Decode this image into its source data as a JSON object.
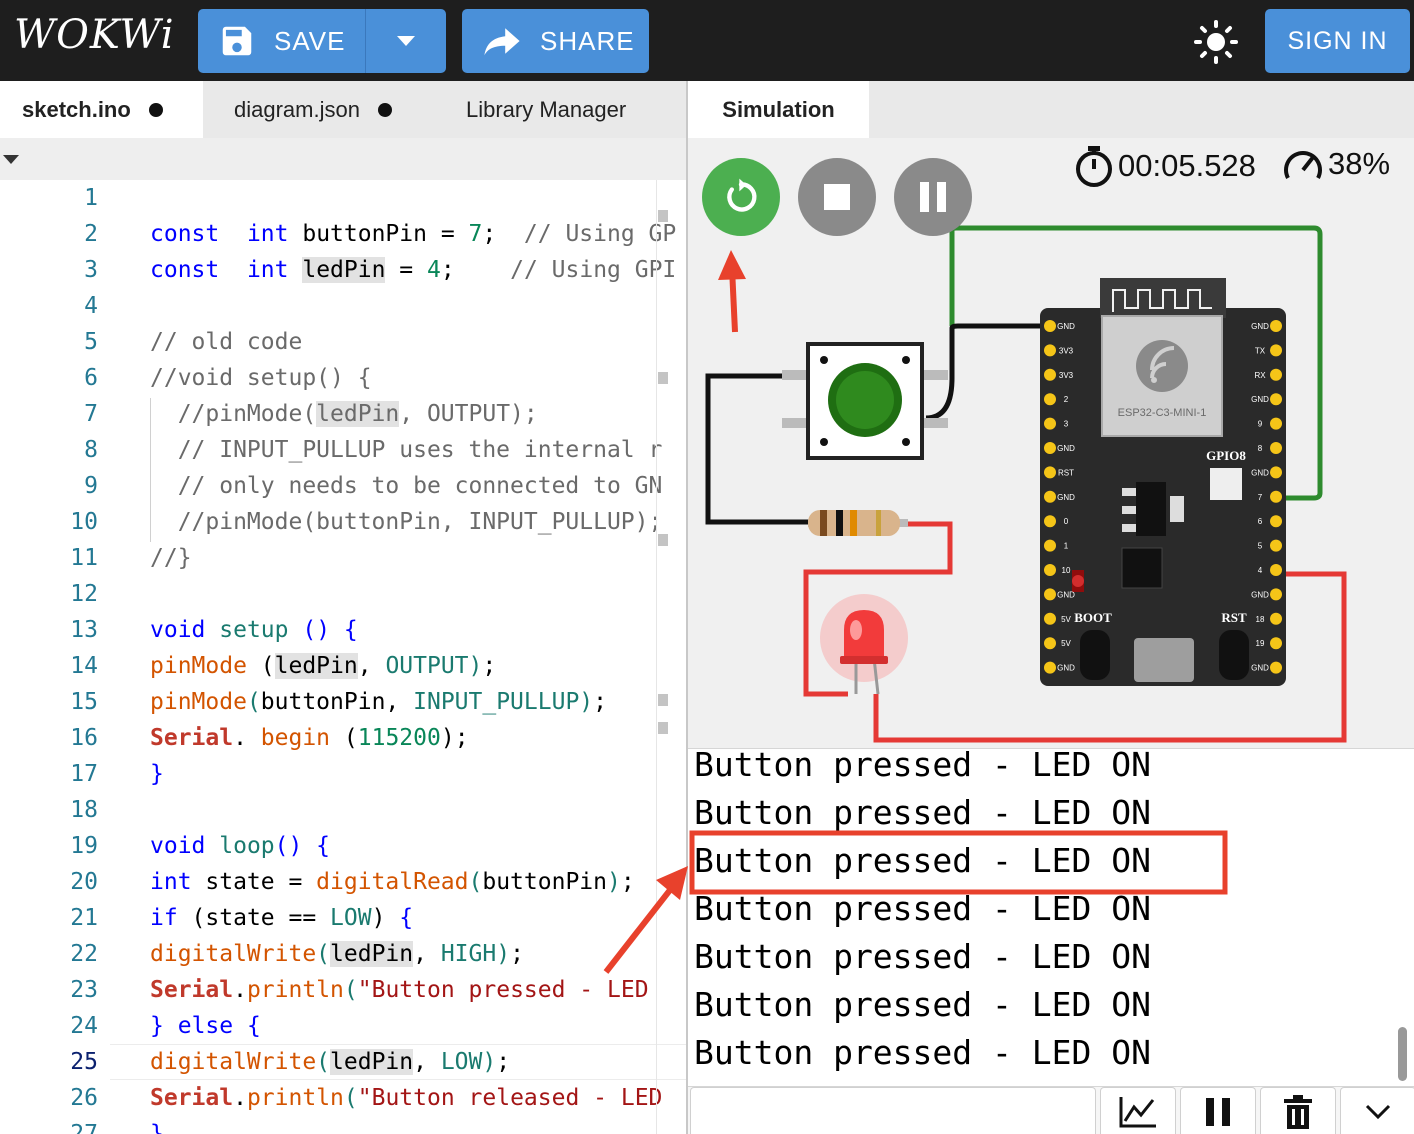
{
  "app": {
    "logo": "WOKWi",
    "save_label": "SAVE",
    "share_label": "SHARE",
    "signin_label": "SIGN IN"
  },
  "tabs": [
    {
      "label": "sketch.ino",
      "active": true,
      "modified": true
    },
    {
      "label": "diagram.json",
      "active": false,
      "modified": true
    },
    {
      "label": "Library Manager",
      "active": false,
      "modified": false
    }
  ],
  "simulation": {
    "tab_label": "Simulation",
    "timer": "00:05.528",
    "speed": "38%",
    "board_label": "ESP32-C3-MINI-1",
    "gpio_label": "GPIO8",
    "boot_label": "BOOT",
    "rst_label": "RST",
    "left_pins": "GND 3V3 3V3 2 3 GND RST GND 0 1 10 GND 5V 5V GND",
    "right_pins": "GND TX RX GND 9 8 GND 7 6 5 4 GND 18 19 GND"
  },
  "code": {
    "current_line": 25,
    "lines": [
      {
        "n": "1",
        "parts": []
      },
      {
        "n": "2",
        "parts": [
          [
            "kw",
            "const"
          ],
          [
            "",
            "  "
          ],
          [
            "kw",
            "int"
          ],
          [
            "",
            " buttonPin = "
          ],
          [
            "num",
            "7"
          ],
          [
            "",
            ";  "
          ],
          [
            "cm",
            "// Using GP"
          ]
        ]
      },
      {
        "n": "3",
        "parts": [
          [
            "kw",
            "const"
          ],
          [
            "",
            "  "
          ],
          [
            "kw",
            "int"
          ],
          [
            "",
            " "
          ],
          [
            "hl",
            "ledPin"
          ],
          [
            "",
            " = "
          ],
          [
            "num",
            "4"
          ],
          [
            "",
            ";    "
          ],
          [
            "cm",
            "// Using GPI"
          ]
        ]
      },
      {
        "n": "4",
        "parts": []
      },
      {
        "n": "5",
        "parts": [
          [
            "cm",
            "// old code"
          ]
        ]
      },
      {
        "n": "6",
        "parts": [
          [
            "cm",
            "//void setup() {"
          ]
        ]
      },
      {
        "n": "7",
        "parts": [
          [
            "cm",
            "  //pinMode("
          ],
          [
            "cmhl",
            "ledPin"
          ],
          [
            "cm",
            ", OUTPUT);"
          ]
        ]
      },
      {
        "n": "8",
        "parts": [
          [
            "cm",
            "  // INPUT_PULLUP uses the internal r"
          ]
        ]
      },
      {
        "n": "9",
        "parts": [
          [
            "cm",
            "  // only needs to be connected to GN"
          ]
        ]
      },
      {
        "n": "10",
        "parts": [
          [
            "cm",
            "  //pinMode(buttonPin, INPUT_PULLUP);"
          ]
        ]
      },
      {
        "n": "11",
        "parts": [
          [
            "cm",
            "//}"
          ]
        ]
      },
      {
        "n": "12",
        "parts": []
      },
      {
        "n": "13",
        "parts": [
          [
            "kw",
            "void"
          ],
          [
            "",
            " "
          ],
          [
            "tk",
            "setup"
          ],
          [
            "",
            " "
          ],
          [
            "kw",
            "() {"
          ]
        ]
      },
      {
        "n": "14",
        "parts": [
          [
            "fn",
            "pinMode"
          ],
          [
            "",
            " ("
          ],
          [
            "hl",
            "ledPin"
          ],
          [
            "",
            ", "
          ],
          [
            "tk",
            "OUTPUT"
          ],
          [
            "tk",
            ")"
          ],
          [
            "",
            ";"
          ]
        ]
      },
      {
        "n": "15",
        "parts": [
          [
            "fn",
            "pinMode"
          ],
          [
            "tk",
            "("
          ],
          [
            "",
            "buttonPin, "
          ],
          [
            "tk",
            "INPUT_PULLUP"
          ],
          [
            "tk",
            ")"
          ],
          [
            "",
            ";"
          ]
        ]
      },
      {
        "n": "16",
        "parts": [
          [
            "obj",
            "Serial"
          ],
          [
            "",
            ". "
          ],
          [
            "fn",
            "begin"
          ],
          [
            "",
            " ("
          ],
          [
            "num",
            "115200"
          ],
          [
            "",
            ");"
          ]
        ]
      },
      {
        "n": "17",
        "parts": [
          [
            "kw",
            "}"
          ]
        ]
      },
      {
        "n": "18",
        "parts": []
      },
      {
        "n": "19",
        "parts": [
          [
            "kw",
            "void"
          ],
          [
            "",
            " "
          ],
          [
            "tk",
            "loop"
          ],
          [
            "kw",
            "() {"
          ]
        ]
      },
      {
        "n": "20",
        "parts": [
          [
            "kw",
            "int"
          ],
          [
            "",
            " state = "
          ],
          [
            "fn",
            "digitalRead"
          ],
          [
            "tk",
            "("
          ],
          [
            "",
            "buttonPin"
          ],
          [
            "tk",
            ")"
          ],
          [
            "",
            ";"
          ]
        ]
      },
      {
        "n": "21",
        "parts": [
          [
            "kw",
            "if"
          ],
          [
            "",
            " ("
          ],
          [
            "",
            "state == "
          ],
          [
            "tk",
            "LOW"
          ],
          [
            "",
            ")"
          ],
          [
            "kw",
            " {"
          ]
        ]
      },
      {
        "n": "22",
        "parts": [
          [
            "fn",
            "digitalWrite"
          ],
          [
            "tk",
            "("
          ],
          [
            "hl",
            "ledPin"
          ],
          [
            "",
            ", "
          ],
          [
            "tk",
            "HIGH"
          ],
          [
            "tk",
            ")"
          ],
          [
            "",
            ";"
          ]
        ]
      },
      {
        "n": "23",
        "parts": [
          [
            "obj",
            "Serial"
          ],
          [
            "",
            "."
          ],
          [
            "fn",
            "println"
          ],
          [
            "tk",
            "("
          ],
          [
            "str",
            "\"Button pressed - LED"
          ]
        ]
      },
      {
        "n": "24",
        "parts": [
          [
            "kw",
            "}"
          ],
          [
            "",
            " "
          ],
          [
            "kw",
            "else"
          ],
          [
            "",
            " "
          ],
          [
            "kw",
            "{"
          ]
        ]
      },
      {
        "n": "25",
        "parts": [
          [
            "fn",
            "digitalWrite"
          ],
          [
            "tk",
            "("
          ],
          [
            "hl",
            "ledPin"
          ],
          [
            "",
            ", "
          ],
          [
            "tk",
            "LOW"
          ],
          [
            "tk",
            ")"
          ],
          [
            "",
            ";"
          ]
        ]
      },
      {
        "n": "26",
        "parts": [
          [
            "obj",
            "Serial"
          ],
          [
            "",
            "."
          ],
          [
            "fn",
            "println"
          ],
          [
            "tk",
            "("
          ],
          [
            "str",
            "\"Button released - LED"
          ]
        ]
      },
      {
        "n": "27",
        "parts": [
          [
            "kw",
            "}"
          ]
        ]
      }
    ]
  },
  "serial": {
    "lines": [
      "Button pressed - LED ON",
      "Button pressed - LED ON",
      "Button pressed - LED ON",
      "Button pressed - LED ON",
      "Button pressed - LED ON",
      "Button pressed - LED ON",
      "Button pressed - LED ON"
    ],
    "input_placeholder": ""
  },
  "colors": {
    "topbar": "#1e1e1e",
    "accent_blue": "#4a90d9",
    "run_green": "#4caf50",
    "annotation_red": "#e8412c"
  },
  "icons": [
    "save-icon",
    "chevron-down-icon",
    "share-icon",
    "sun-icon",
    "restart-icon",
    "stop-icon",
    "pause-icon",
    "stopwatch-icon",
    "speedometer-icon",
    "chart-icon",
    "pause-icon",
    "trash-icon",
    "chevron-down-icon"
  ]
}
